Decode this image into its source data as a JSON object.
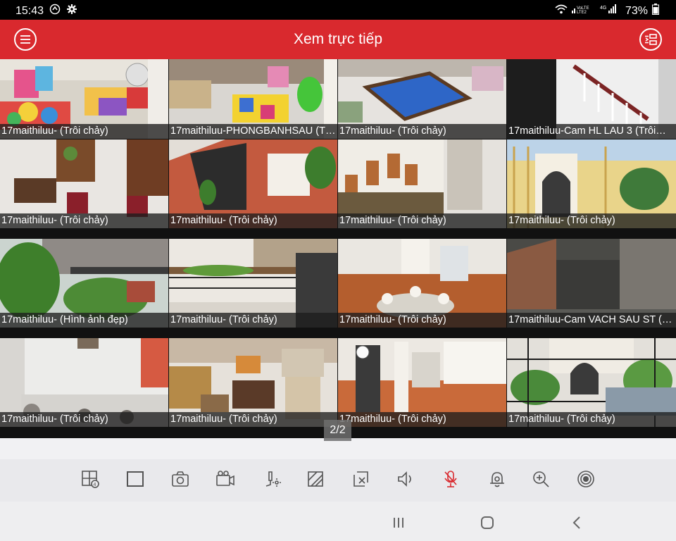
{
  "status_bar": {
    "time": "15:43",
    "battery": "73%",
    "network": "4G",
    "volte": "VoLTE2"
  },
  "app_bar": {
    "title": "Xem trực tiếp",
    "menu_icon": "menu-icon",
    "layout_icon": "channel-list-icon"
  },
  "tiles": [
    {
      "label": "17maithiluu- (Trôi chảy)",
      "selected": true
    },
    {
      "label": "17maithiluu-PHONGBANHSAU (T…"
    },
    {
      "label": "17maithiluu- (Trôi chảy)"
    },
    {
      "label": "17maithiluu-Cam HL LAU 3 (Trôi…"
    },
    {
      "label": "17maithiluu- (Trôi chảy)"
    },
    {
      "label": "17maithiluu- (Trôi chảy)"
    },
    {
      "label": "17maithiluu- (Trôi chảy)"
    },
    {
      "label": "17maithiluu- (Trôi chảy)"
    },
    {
      "label": "17maithiluu- (Hình ảnh đẹp)"
    },
    {
      "label": "17maithiluu- (Trôi chảy)"
    },
    {
      "label": "17maithiluu- (Trôi chảy)"
    },
    {
      "label": "17maithiluu-Cam VACH SAU ST (…"
    },
    {
      "label": "17maithiluu- (Trôi chảy)"
    },
    {
      "label": "17maithiluu- (Trôi chảy)"
    },
    {
      "label": "17maithiluu- (Trôi chảy)"
    },
    {
      "label": "17maithiluu- (Trôi chảy)"
    }
  ],
  "page_indicator": "2/2",
  "toolbar": [
    "split-screen-icon",
    "single-screen-icon",
    "snapshot-icon",
    "record-icon",
    "ptz-icon",
    "image-quality-icon",
    "stop-all-icon",
    "audio-icon",
    "talk-icon",
    "alarm-icon",
    "digital-zoom-icon",
    "fisheye-icon"
  ],
  "navbar": [
    "recents-icon",
    "home-icon",
    "back-icon"
  ],
  "colors": {
    "accent": "#d9292e",
    "caption_bg": "#1e1e1e",
    "toolbar_icon": "#555555",
    "talk_icon": "#d9292e"
  }
}
